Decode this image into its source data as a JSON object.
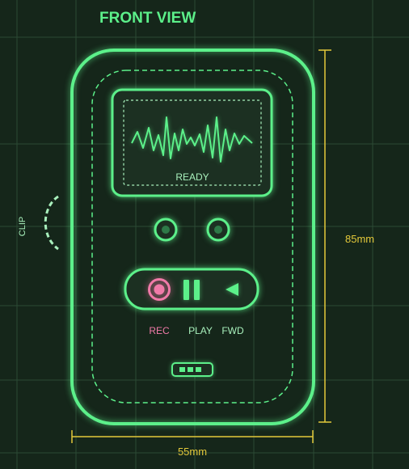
{
  "title": "FRONT VIEW",
  "screen": {
    "status": "READY"
  },
  "controls": {
    "rec_label": "REC",
    "play_label": "PLAY",
    "fwd_label": "FWD"
  },
  "clip_label": "CLIP",
  "dimensions": {
    "height": "85mm",
    "width": "55mm"
  },
  "colors": {
    "background": "#15261a",
    "grid": "#2c4a34",
    "neon_green": "#5cf08a",
    "rec_pink": "#f07aa8",
    "dimension_yellow": "#e3c83a",
    "label_green": "#a8f0bc",
    "screen_fill": "#1c3022"
  },
  "icons": {
    "record": "record-icon",
    "pause": "pause-icon",
    "forward": "forward-triangle-icon",
    "speaker": "speaker-grille-icon"
  }
}
